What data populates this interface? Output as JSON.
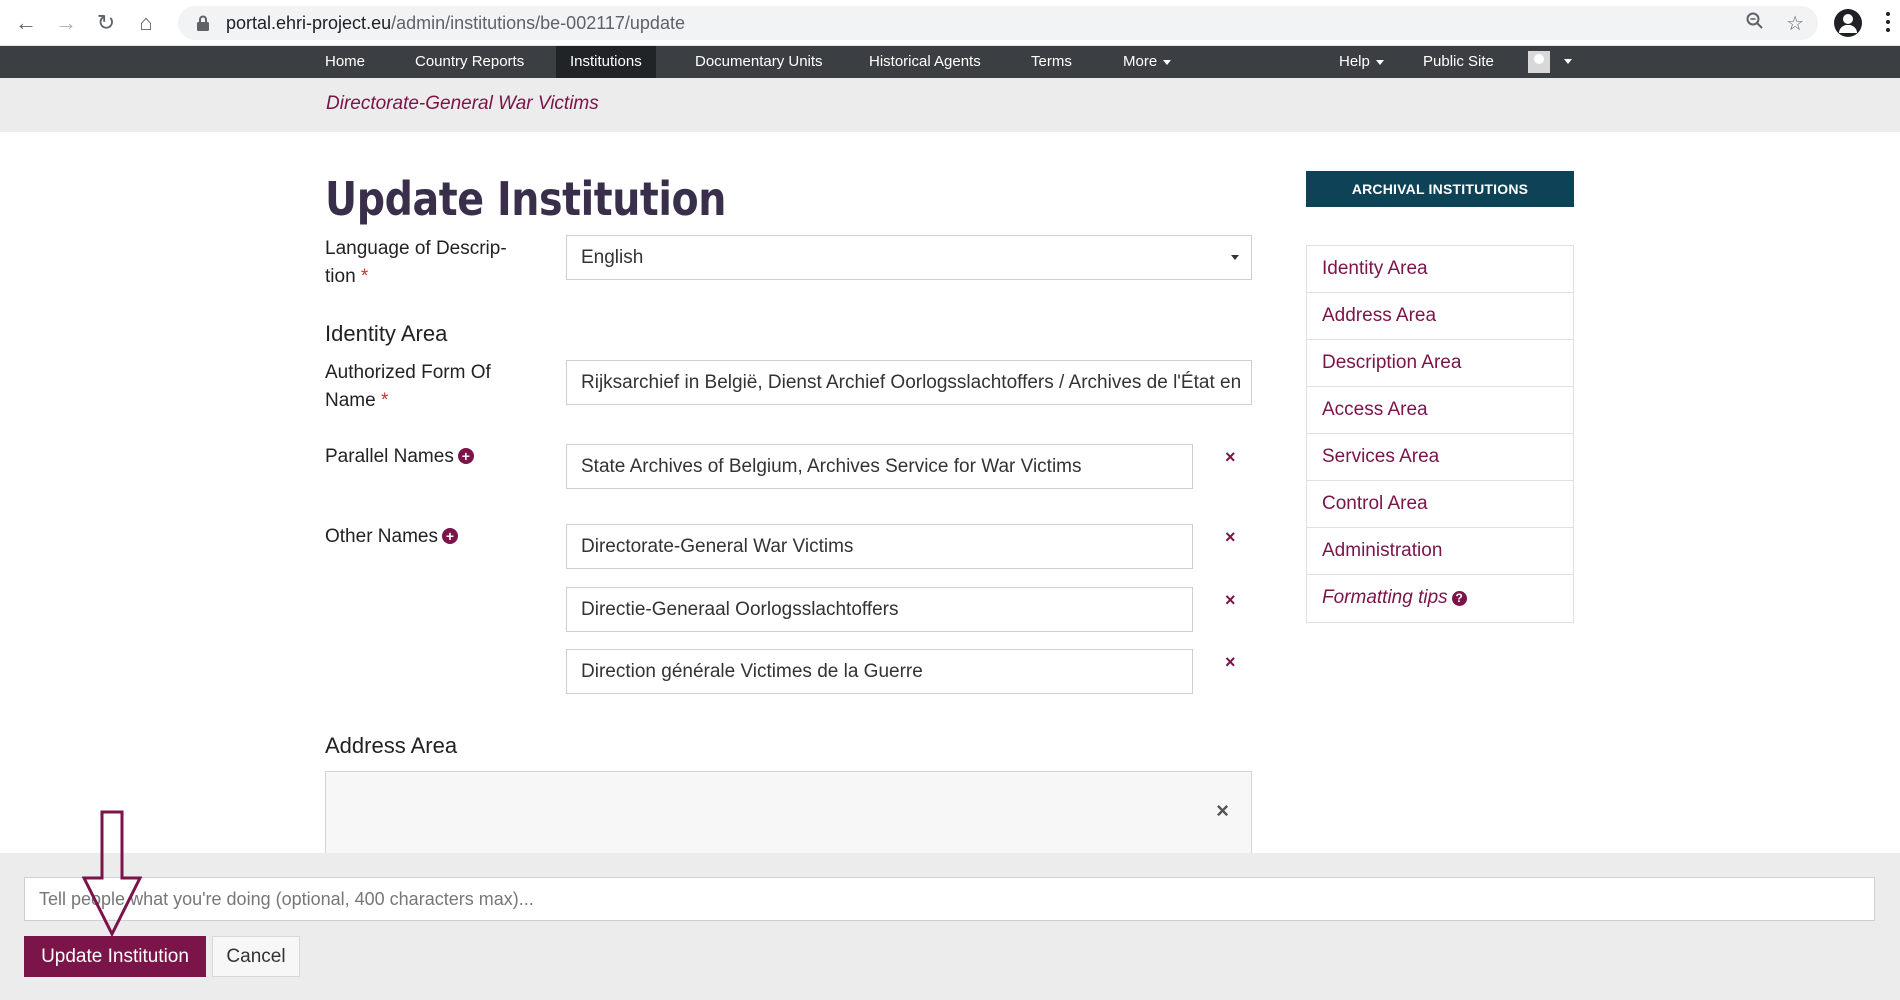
{
  "browser": {
    "url_host": "portal.ehri-project.eu",
    "url_path": "/admin/institutions/be-002117/update"
  },
  "nav": {
    "items": [
      "Home",
      "Country Reports",
      "Institutions",
      "Documentary Units",
      "Historical Agents",
      "Terms",
      "More"
    ],
    "active": "Institutions",
    "help": "Help",
    "public_site": "Public Site"
  },
  "breadcrumb": "Directorate-General War Victims",
  "page_title": "Update Institution",
  "form": {
    "language_label": "Language of Descrip-",
    "language_label_2": "tion",
    "language_value": "English",
    "identity_heading": "Identity Area",
    "authorized_label": "Authorized Form Of",
    "authorized_label_2": "Name",
    "authorized_value": "Rijksarchief in België, Dienst Archief Oorlogsslachtoffers / Archives de l'État en",
    "parallel_label": "Parallel Names",
    "parallel_values": [
      "State Archives of Belgium, Archives Service for War Victims"
    ],
    "other_label": "Other Names",
    "other_values": [
      "Directorate-General War Victims",
      "Directie-Generaal Oorlogsslachtoffers",
      "Direction générale Victimes de la Guerre"
    ],
    "address_heading": "Address Area",
    "required_mark": "*",
    "remove_mark": "×"
  },
  "sidebar": {
    "heading": "ARCHIVAL INSTITUTIONS",
    "items": [
      "Identity Area",
      "Address Area",
      "Description Area",
      "Access Area",
      "Services Area",
      "Control Area",
      "Administration",
      "Formatting tips"
    ]
  },
  "actions": {
    "log_placeholder": "Tell people what you're doing (optional, 400 characters max)...",
    "submit": "Update Institution",
    "cancel": "Cancel"
  },
  "colors": {
    "accent": "#7a1449",
    "navbar": "#3b3f44",
    "sidebar_head": "#0e4357"
  }
}
